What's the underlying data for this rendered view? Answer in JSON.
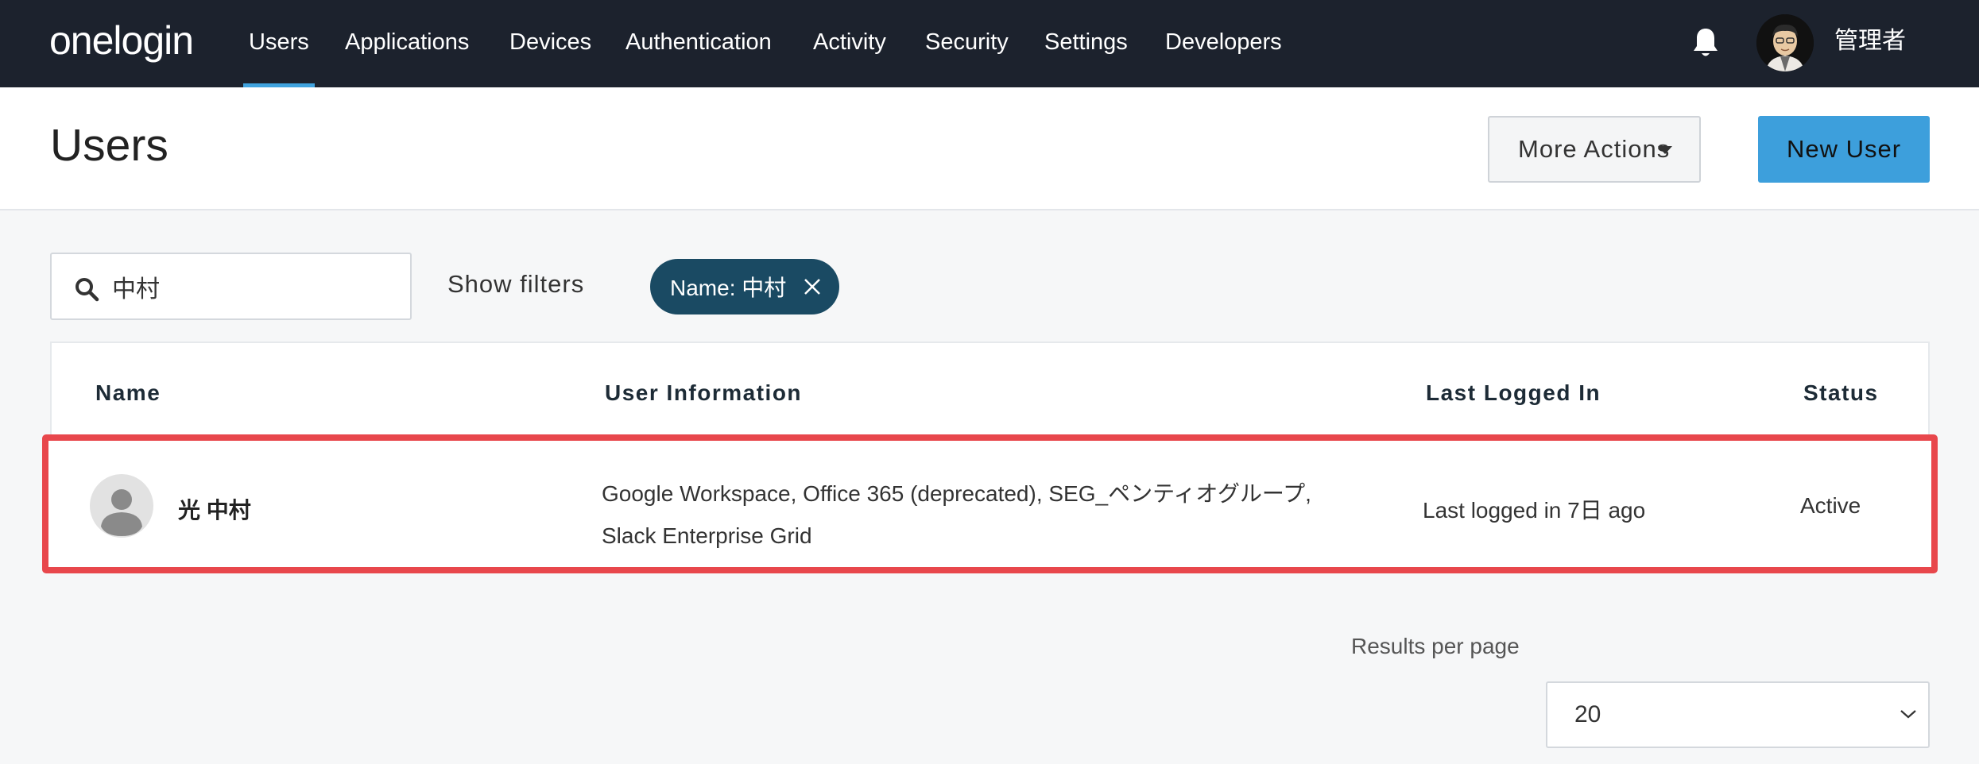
{
  "app": {
    "logo": "onelogin"
  },
  "nav": {
    "items": [
      {
        "label": "Users",
        "active": true
      },
      {
        "label": "Applications"
      },
      {
        "label": "Devices"
      },
      {
        "label": "Authentication"
      },
      {
        "label": "Activity"
      },
      {
        "label": "Security"
      },
      {
        "label": "Settings"
      },
      {
        "label": "Developers"
      }
    ],
    "notification_icon": "bell-icon",
    "user_name": "管理者"
  },
  "header": {
    "title": "Users",
    "more_actions_label": "More Actions",
    "new_user_label": "New User"
  },
  "filters": {
    "search_value": "中村",
    "show_filters_label": "Show filters",
    "active_chip": "Name: 中村"
  },
  "table": {
    "columns": [
      "Name",
      "User Information",
      "Last Logged In",
      "Status"
    ],
    "rows": [
      {
        "name": "光 中村",
        "info": "Google Workspace, Office 365 (deprecated), SEG_ペンティオグループ, Slack Enterprise Grid",
        "last_logged_in": "Last logged in 7日 ago",
        "status": "Active"
      }
    ]
  },
  "pagination": {
    "results_per_page_label": "Results per page",
    "results_per_page_value": "20"
  },
  "colors": {
    "nav_bg": "#1c222d",
    "accent": "#40a3de",
    "primary_button": "#3d9fdc",
    "chip_bg": "#1a4a63",
    "highlight_border": "#e8474c"
  }
}
